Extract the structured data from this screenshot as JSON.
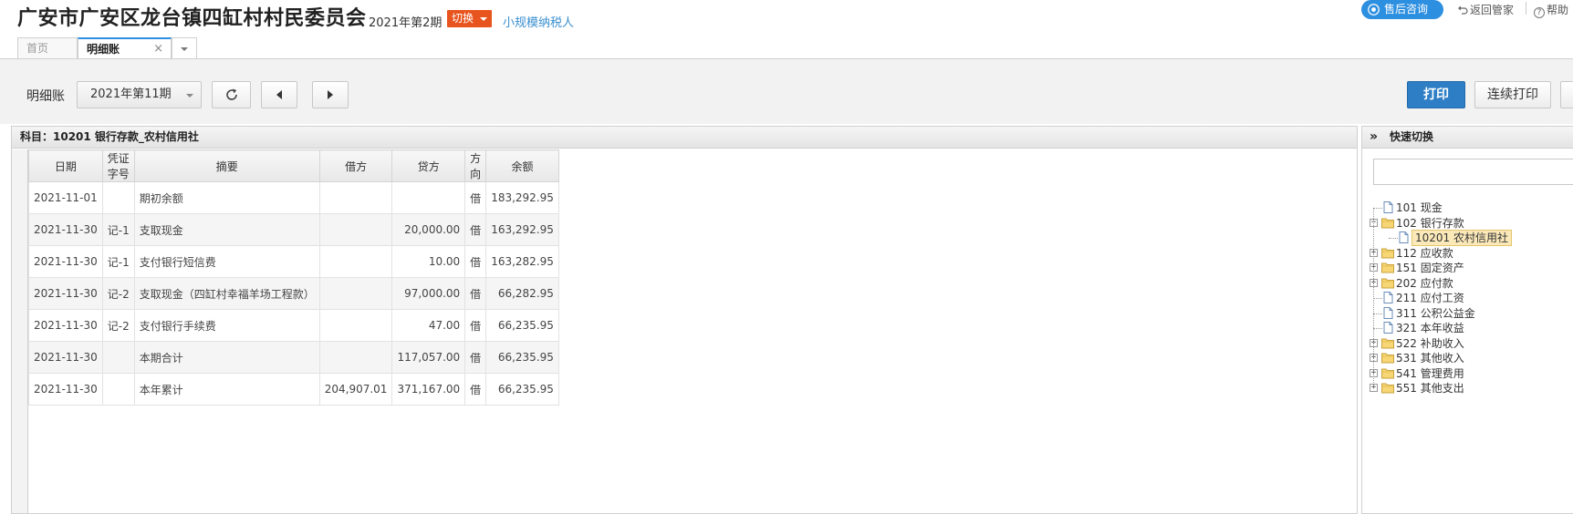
{
  "header": {
    "org_name": "广安市广安区龙台镇四缸村村民委员会",
    "period": "2021年第2期",
    "switch_label": "切换",
    "taxpayer_type": "小规模纳税人",
    "support_label": "售后咨询",
    "back_label": "返回管家",
    "help_label": "帮助"
  },
  "tabs": [
    {
      "label": "首页"
    },
    {
      "label": "明细账",
      "close": "×"
    }
  ],
  "toolbar": {
    "label": "明细账",
    "period_select": "2021年第11期",
    "print_label": "打印",
    "continuous_print_label": "连续打印"
  },
  "ledger": {
    "subject_title": "科目：10201  银行存款_农村信用社",
    "columns": [
      "日期",
      "凭证字号",
      "摘要",
      "借方",
      "贷方",
      "方向",
      "余额"
    ],
    "rows": [
      {
        "date": "2021-11-01",
        "voucher": "",
        "summary": "期初余额",
        "debit": "",
        "credit": "",
        "dir": "借",
        "balance": "183,292.95",
        "indent": true
      },
      {
        "date": "2021-11-30",
        "voucher": "记-1",
        "summary": "支取现金",
        "debit": "",
        "credit": "20,000.00",
        "dir": "借",
        "balance": "163,292.95",
        "indent": false
      },
      {
        "date": "2021-11-30",
        "voucher": "记-1",
        "summary": "支付银行短信费",
        "debit": "",
        "credit": "10.00",
        "dir": "借",
        "balance": "163,282.95",
        "indent": false
      },
      {
        "date": "2021-11-30",
        "voucher": "记-2",
        "summary": "支取现金（四缸村幸福羊场工程款）",
        "debit": "",
        "credit": "97,000.00",
        "dir": "借",
        "balance": "66,282.95",
        "indent": false
      },
      {
        "date": "2021-11-30",
        "voucher": "记-2",
        "summary": "支付银行手续费",
        "debit": "",
        "credit": "47.00",
        "dir": "借",
        "balance": "66,235.95",
        "indent": false
      },
      {
        "date": "2021-11-30",
        "voucher": "",
        "summary": "本期合计",
        "debit": "",
        "credit": "117,057.00",
        "dir": "借",
        "balance": "66,235.95",
        "indent": true
      },
      {
        "date": "2021-11-30",
        "voucher": "",
        "summary": "本年累计",
        "debit": "204,907.01",
        "credit": "371,167.00",
        "dir": "借",
        "balance": "66,235.95",
        "indent": true
      }
    ]
  },
  "quick_switch": {
    "title": "快速切换",
    "toggle_icon": "»",
    "tree": [
      {
        "code": "101",
        "name": "现金",
        "type": "file",
        "level": 0,
        "toggle": ""
      },
      {
        "code": "102",
        "name": "银行存款",
        "type": "folder",
        "level": 0,
        "toggle": "−"
      },
      {
        "code": "10201",
        "name": "农村信用社",
        "type": "file",
        "level": 1,
        "toggle": "",
        "selected": true
      },
      {
        "code": "112",
        "name": "应收款",
        "type": "folder",
        "level": 0,
        "toggle": "+"
      },
      {
        "code": "151",
        "name": "固定资产",
        "type": "folder",
        "level": 0,
        "toggle": "+"
      },
      {
        "code": "202",
        "name": "应付款",
        "type": "folder",
        "level": 0,
        "toggle": "+"
      },
      {
        "code": "211",
        "name": "应付工资",
        "type": "file",
        "level": 0,
        "toggle": ""
      },
      {
        "code": "311",
        "name": "公积公益金",
        "type": "file",
        "level": 0,
        "toggle": ""
      },
      {
        "code": "321",
        "name": "本年收益",
        "type": "file",
        "level": 0,
        "toggle": ""
      },
      {
        "code": "522",
        "name": "补助收入",
        "type": "folder",
        "level": 0,
        "toggle": "+"
      },
      {
        "code": "531",
        "name": "其他收入",
        "type": "folder",
        "level": 0,
        "toggle": "+"
      },
      {
        "code": "541",
        "name": "管理费用",
        "type": "folder",
        "level": 0,
        "toggle": "+"
      },
      {
        "code": "551",
        "name": "其他支出",
        "type": "folder",
        "level": 0,
        "toggle": "+"
      }
    ]
  },
  "icons": {
    "support": "eye-icon",
    "back": "undo-arrow-icon",
    "help": "question-circle-icon",
    "refresh": "refresh-icon",
    "prev": "triangle-left-icon",
    "next": "triangle-right-icon",
    "file": "file-icon",
    "folder": "folder-icon"
  },
  "colors": {
    "switch_button": "#e8541e",
    "link": "#3a8fcf",
    "support_pill": "#2d8fe0",
    "print_button": "#2e7ec6",
    "selected_node": "#fbe9b9"
  }
}
